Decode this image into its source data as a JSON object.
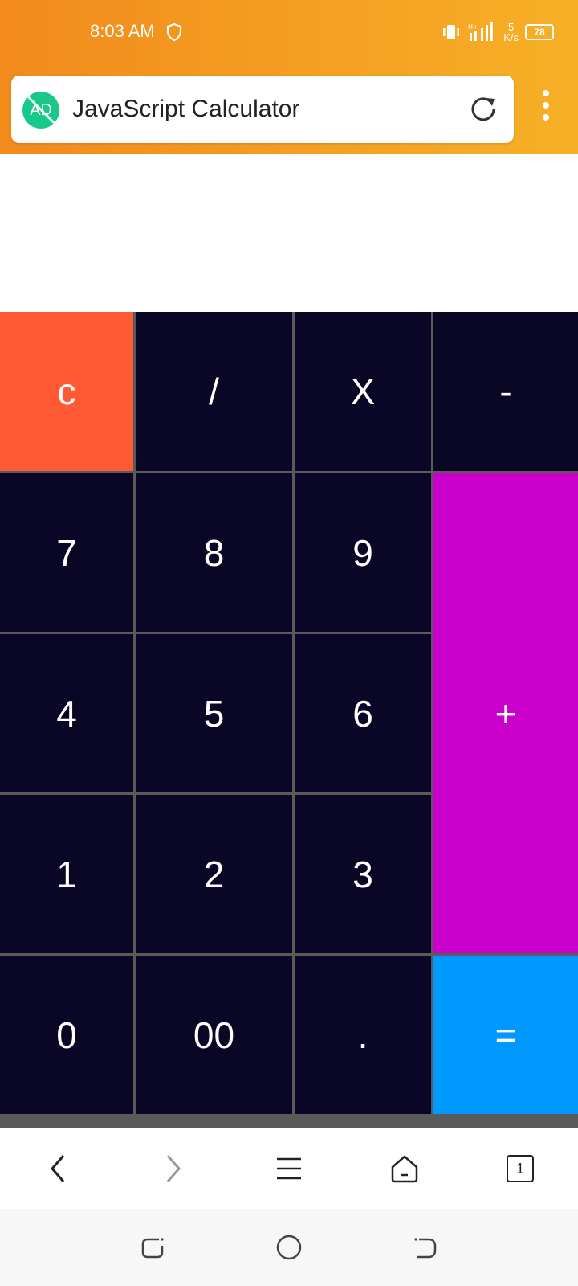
{
  "status_bar": {
    "time": "8:03 AM",
    "net_speed_value": "5",
    "net_speed_unit": "K/s",
    "battery": "78"
  },
  "browser": {
    "page_title": "JavaScript Calculator",
    "ad_badge": "AD",
    "tabs_count": "1"
  },
  "calculator": {
    "display": "",
    "keys": {
      "clear": "c",
      "divide": "/",
      "multiply": "X",
      "minus": "-",
      "seven": "7",
      "eight": "8",
      "nine": "9",
      "plus": "+",
      "four": "4",
      "five": "5",
      "six": "6",
      "one": "1",
      "two": "2",
      "three": "3",
      "zero": "0",
      "double_zero": "00",
      "dot": ".",
      "equals": "="
    },
    "colors": {
      "key_bg": "#0a0626",
      "clear": "#ff5a33",
      "plus": "#cc00cc",
      "equals": "#0099ff",
      "header": "#f5a524"
    }
  }
}
